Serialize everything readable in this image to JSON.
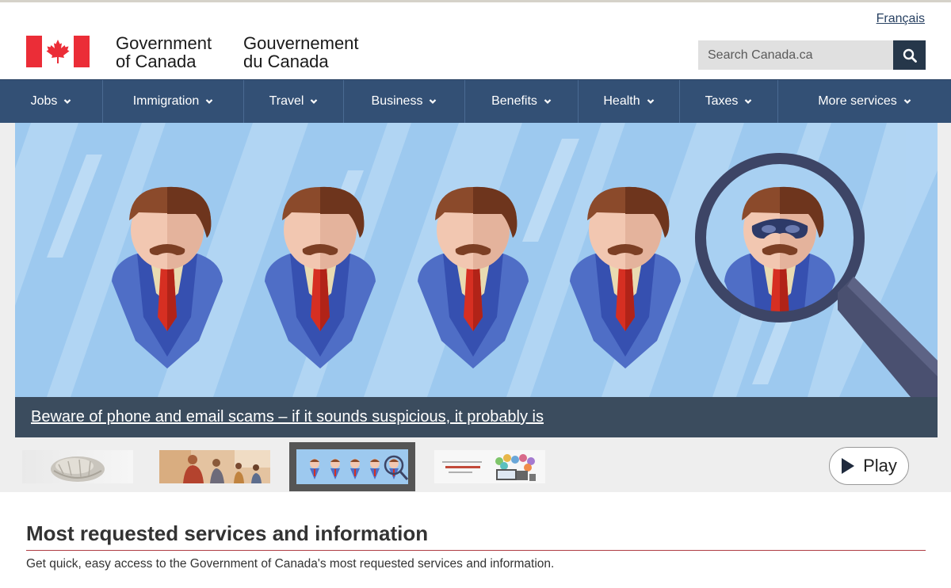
{
  "header": {
    "language_link": "Français",
    "wordmark_en_line1": "Government",
    "wordmark_en_line2": "of Canada",
    "wordmark_fr_line1": "Gouvernement",
    "wordmark_fr_line2": "du Canada",
    "search_placeholder": "Search Canada.ca",
    "search_icon": "search-icon",
    "flag_icon": "canada-flag-icon"
  },
  "nav": {
    "items": [
      {
        "label": "Jobs"
      },
      {
        "label": "Immigration"
      },
      {
        "label": "Travel"
      },
      {
        "label": "Business"
      },
      {
        "label": "Benefits"
      },
      {
        "label": "Health"
      },
      {
        "label": "Taxes"
      },
      {
        "label": "More services"
      }
    ]
  },
  "carousel": {
    "caption": "Beware of phone and email scams – if it sounds suspicious, it probably is",
    "play_label": "Play",
    "active_slide_index": 2,
    "slide_count": 4
  },
  "section": {
    "title": "Most requested services and information",
    "description": "Get quick, easy access to the Government of Canada's most requested services and information."
  },
  "colors": {
    "nav_bg": "#335075",
    "search_button": "#26374a",
    "flag_red": "#eb2d37",
    "caption_bg": "#3b4c5e",
    "section_rule": "#af3c43"
  }
}
